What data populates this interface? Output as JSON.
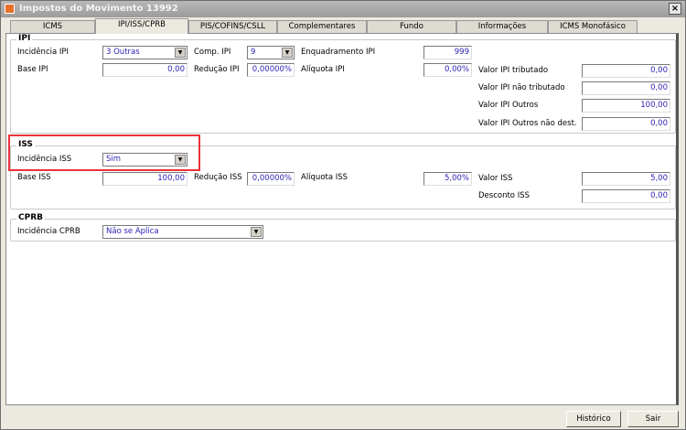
{
  "window": {
    "title": "Impostos do Movimento 13992",
    "close": "×"
  },
  "tabs": [
    "ICMS",
    "IPI/ISS/CPRB",
    "PIS/COFINS/CSLL",
    "Complementares",
    "Fundo Pobreza/Rural/FTI",
    "Informações Adicionais",
    "ICMS Monofásico"
  ],
  "active_tab": "IPI/ISS/CPRB",
  "ipi": {
    "title": "IPI",
    "incidencia_label": "Incidência IPI",
    "incidencia_value": "3 Outras",
    "comp_label": "Comp. IPI",
    "comp_value": "9",
    "enquadramento_label": "Enquadramento IPI",
    "enquadramento_value": "999",
    "base_label": "Base IPI",
    "base_value": "0,00",
    "reducao_label": "Redução IPI",
    "reducao_value": "0,00000%",
    "aliquota_label": "Alíquota IPI",
    "aliquota_value": "0,00%",
    "tributado_label": "Valor IPI tributado",
    "tributado_value": "0,00",
    "nao_tributado_label": "Valor IPI não tributado",
    "nao_tributado_value": "0,00",
    "outros_label": "Valor IPI Outros",
    "outros_value": "100,00",
    "outros_nao_dest_label": "Valor IPI Outros não dest.",
    "outros_nao_dest_value": "0,00"
  },
  "iss": {
    "title": "ISS",
    "incidencia_label": "Incidência ISS",
    "incidencia_value": "Sim",
    "base_label": "Base ISS",
    "base_value": "100,00",
    "reducao_label": "Redução ISS",
    "reducao_value": "0,00000%",
    "aliquota_label": "Alíquota ISS",
    "aliquota_value": "5,00%",
    "valor_label": "Valor ISS",
    "valor_value": "5,00",
    "desconto_label": "Desconto ISS",
    "desconto_value": "0,00"
  },
  "cprb": {
    "title": "CPRB",
    "incidencia_label": "Incidência CPRB",
    "incidencia_value": "Não se Aplica"
  },
  "buttons": {
    "historico": "Histórico",
    "sair": "Sair"
  },
  "colors": {
    "value_text": "#2a1fb0",
    "highlight": "#e8343a"
  }
}
